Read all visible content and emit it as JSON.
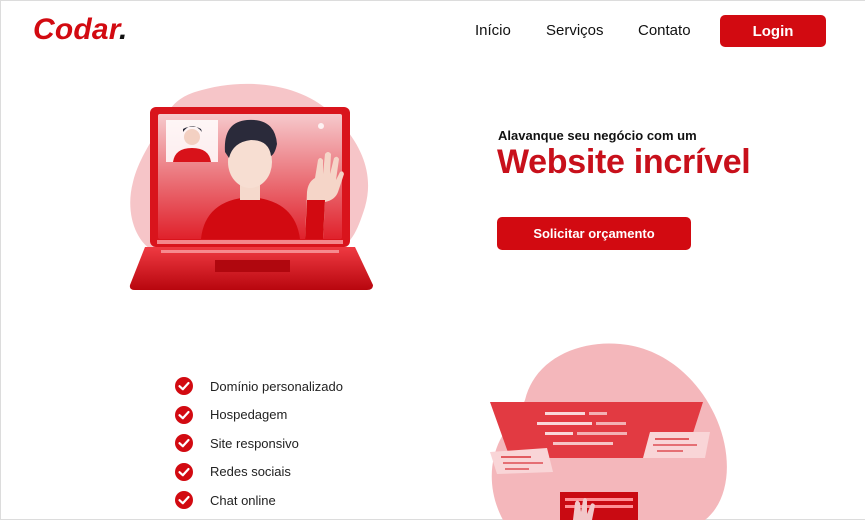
{
  "brand": {
    "name": "Codar",
    "dot": "."
  },
  "nav": {
    "items": [
      {
        "label": "Início"
      },
      {
        "label": "Serviços"
      },
      {
        "label": "Contato"
      }
    ],
    "login_label": "Login"
  },
  "hero": {
    "subtitle": "Alavanque seu negócio com um",
    "title": "Website incrível",
    "cta_label": "Solicitar orçamento"
  },
  "features": [
    "Domínio personalizado",
    "Hospedagem",
    "Site responsivo",
    "Redes sociais",
    "Chat online"
  ],
  "colors": {
    "brand_red": "#d20a11",
    "blob_pink": "#f4b7bb",
    "text_dark": "#111111"
  },
  "icons": {
    "feature_check": "check-circle-icon",
    "hero_illustration": "video-call-laptop-illustration",
    "dev_illustration": "code-editor-illustration"
  }
}
